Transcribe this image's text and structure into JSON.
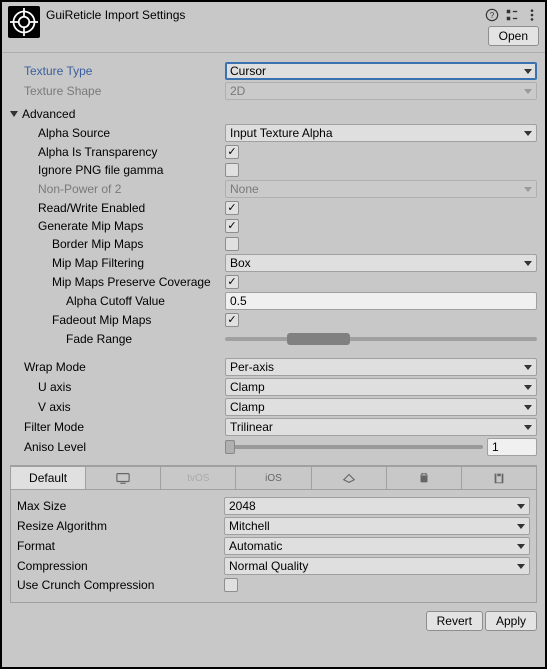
{
  "header": {
    "title": "GuiReticle Import Settings",
    "open": "Open"
  },
  "textureType": {
    "label": "Texture Type",
    "value": "Cursor"
  },
  "textureShape": {
    "label": "Texture Shape",
    "value": "2D"
  },
  "advanced": {
    "label": "Advanced",
    "alphaSource": {
      "label": "Alpha Source",
      "value": "Input Texture Alpha"
    },
    "alphaIsTransparency": {
      "label": "Alpha Is Transparency",
      "checked": true
    },
    "ignorePNG": {
      "label": "Ignore PNG file gamma",
      "checked": false
    },
    "nonPowerOf2": {
      "label": "Non-Power of 2",
      "value": "None"
    },
    "readWrite": {
      "label": "Read/Write Enabled",
      "checked": true
    },
    "genMipMaps": {
      "label": "Generate Mip Maps",
      "checked": true
    },
    "borderMipMaps": {
      "label": "Border Mip Maps",
      "checked": false
    },
    "mipMapFiltering": {
      "label": "Mip Map Filtering",
      "value": "Box"
    },
    "preserveCoverage": {
      "label": "Mip Maps Preserve Coverage",
      "checked": true
    },
    "alphaCutoff": {
      "label": "Alpha Cutoff Value",
      "value": "0.5"
    },
    "fadeoutMipMaps": {
      "label": "Fadeout Mip Maps",
      "checked": true
    },
    "fadeRange": {
      "label": "Fade Range",
      "min": 20,
      "max": 40
    }
  },
  "wrapMode": {
    "label": "Wrap Mode",
    "value": "Per-axis"
  },
  "uAxis": {
    "label": "U axis",
    "value": "Clamp"
  },
  "vAxis": {
    "label": "V axis",
    "value": "Clamp"
  },
  "filterMode": {
    "label": "Filter Mode",
    "value": "Trilinear"
  },
  "anisoLevel": {
    "label": "Aniso Level",
    "value": "1"
  },
  "tabs": {
    "default": "Default"
  },
  "platform": {
    "maxSize": {
      "label": "Max Size",
      "value": "2048"
    },
    "resizeAlg": {
      "label": "Resize Algorithm",
      "value": "Mitchell"
    },
    "format": {
      "label": "Format",
      "value": "Automatic"
    },
    "compression": {
      "label": "Compression",
      "value": "Normal Quality"
    },
    "useCrunch": {
      "label": "Use Crunch Compression",
      "checked": false
    }
  },
  "footer": {
    "revert": "Revert",
    "apply": "Apply"
  }
}
